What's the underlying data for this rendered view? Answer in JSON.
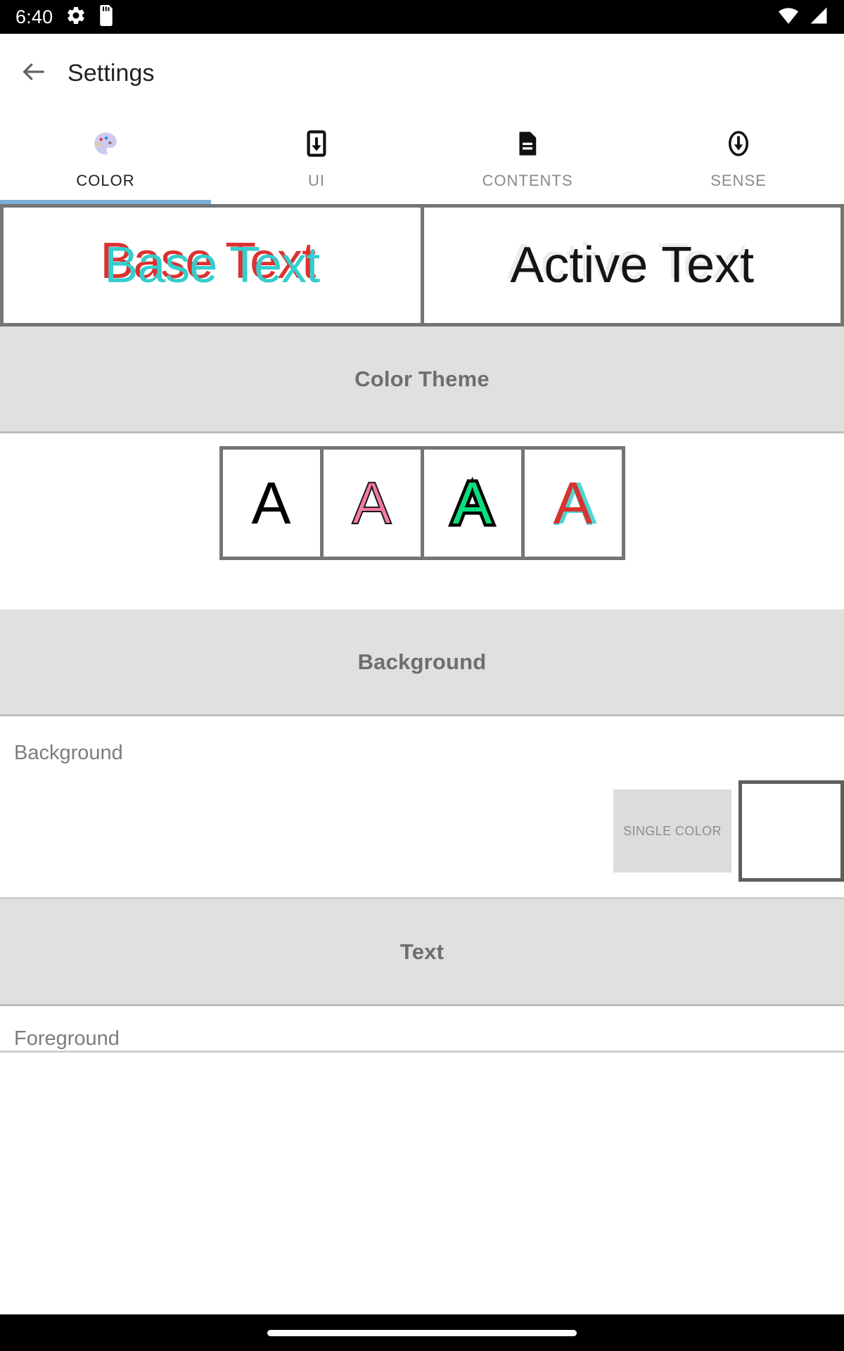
{
  "status_bar": {
    "time": "6:40",
    "icons_left": [
      "settings-gear-icon",
      "sd-card-icon"
    ],
    "icons_right": [
      "wifi-icon",
      "cell-signal-icon"
    ]
  },
  "app_bar": {
    "back_icon": "arrow-back-icon",
    "title": "Settings"
  },
  "tabs": {
    "active_index": 0,
    "items": [
      {
        "label": "COLOR",
        "icon": "palette-icon"
      },
      {
        "label": "UI",
        "icon": "phone-download-icon"
      },
      {
        "label": "CONTENTS",
        "icon": "document-icon"
      },
      {
        "label": "SENSE",
        "icon": "circle-download-icon"
      }
    ]
  },
  "preview": {
    "base": {
      "text": "Base Text",
      "fill": "#35cdcd",
      "shadow": "#dd3131"
    },
    "active": {
      "text": "Active Text",
      "fill": "#141414",
      "shadow": "#ececec"
    }
  },
  "sections": {
    "color_theme": {
      "title": "Color Theme"
    },
    "background": {
      "title": "Background"
    },
    "text": {
      "title": "Text"
    }
  },
  "color_theme": {
    "swatches": [
      {
        "letter": "A",
        "fill": "#000000",
        "outline": "none",
        "style_key": "k1"
      },
      {
        "letter": "A",
        "fill": "#f57ba3",
        "outline": "#1a1a1a",
        "style_key": "k2"
      },
      {
        "letter": "A",
        "fill": "#0bdd7c",
        "outline": "#000000",
        "style_key": "k3"
      },
      {
        "letter": "A",
        "fill": "#d8342f",
        "outline": "#4fd4d4",
        "style_key": "k4"
      }
    ]
  },
  "background_row": {
    "label": "Background",
    "mode_chip": "SINGLE COLOR",
    "color_value": "#ffffff"
  },
  "text_row": {
    "label": "Foreground"
  },
  "nav_bar": {
    "home_indicator": "home-pill"
  },
  "theme": {
    "accent": "#7aafdc",
    "section_bg": "#e0e0e0",
    "section_text": "#6e6e6e",
    "border": "#757575",
    "status_bar_bg": "#000000"
  }
}
